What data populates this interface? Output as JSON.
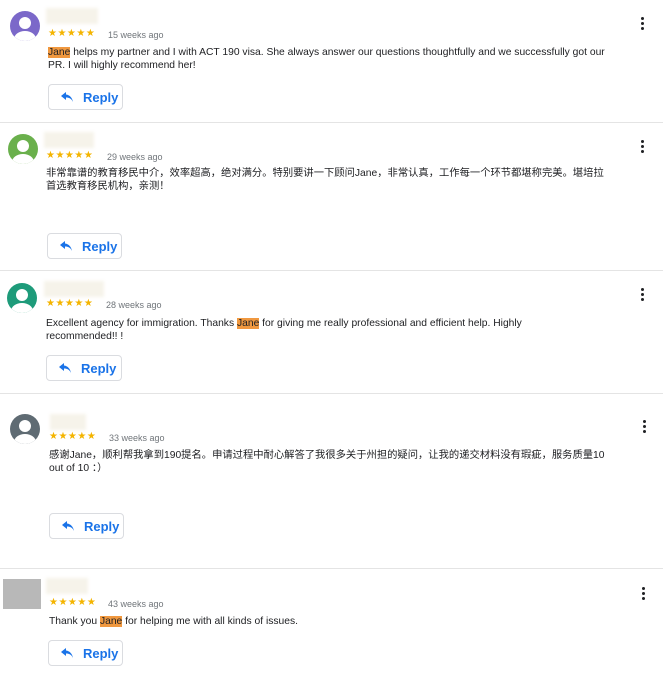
{
  "reviews": [
    {
      "avatar_color": "#7b68c9",
      "avatar_shape": "circle",
      "rating": "★★★★★",
      "time": "15 weeks ago",
      "text": "Jane helps my partner and I with ACT 190 visa. She always answer our questions thoughtfully and we successfully got our PR. I will highly recommend her!",
      "highlight": "Jane",
      "reply_label": "Reply"
    },
    {
      "avatar_color": "#6ab04c",
      "avatar_shape": "circle",
      "rating": "★★★★★",
      "time": "29 weeks ago",
      "text": "非常靠谱的教育移民中介，效率超高，绝对满分。特别要讲一下顾问Jane，非常认真，工作每一个环节都堪称完美。堪培拉首选教育移民机构，亲测！",
      "highlight": "",
      "reply_label": "Reply"
    },
    {
      "avatar_color": "#1e9b7a",
      "avatar_shape": "circle",
      "rating": "★★★★★",
      "time": "28 weeks ago",
      "text": "Excellent agency for immigration. Thanks Jane for giving me really professional and efficient help. Highly recommended!! !",
      "highlight": "Jane",
      "reply_label": "Reply"
    },
    {
      "avatar_color": "#5f6b73",
      "avatar_shape": "circle",
      "rating": "★★★★★",
      "time": "33 weeks ago",
      "text": "感谢Jane，顺利帮我拿到190提名。申请过程中耐心解答了我很多关于州担的疑问，让我的递交材料没有瑕疵，服务质量10 out of 10 ：）",
      "highlight": "",
      "reply_label": "Reply"
    },
    {
      "avatar_color": "#b8b8b8",
      "avatar_shape": "square",
      "rating": "★★★★★",
      "time": "43 weeks ago",
      "text": "Thank you Jane for helping me with all kinds of issues.",
      "highlight": "Jane",
      "reply_label": "Reply"
    }
  ],
  "icons": {
    "reply": "reply-arrow-icon",
    "menu": "more-vert-icon",
    "avatar": "person-icon"
  }
}
